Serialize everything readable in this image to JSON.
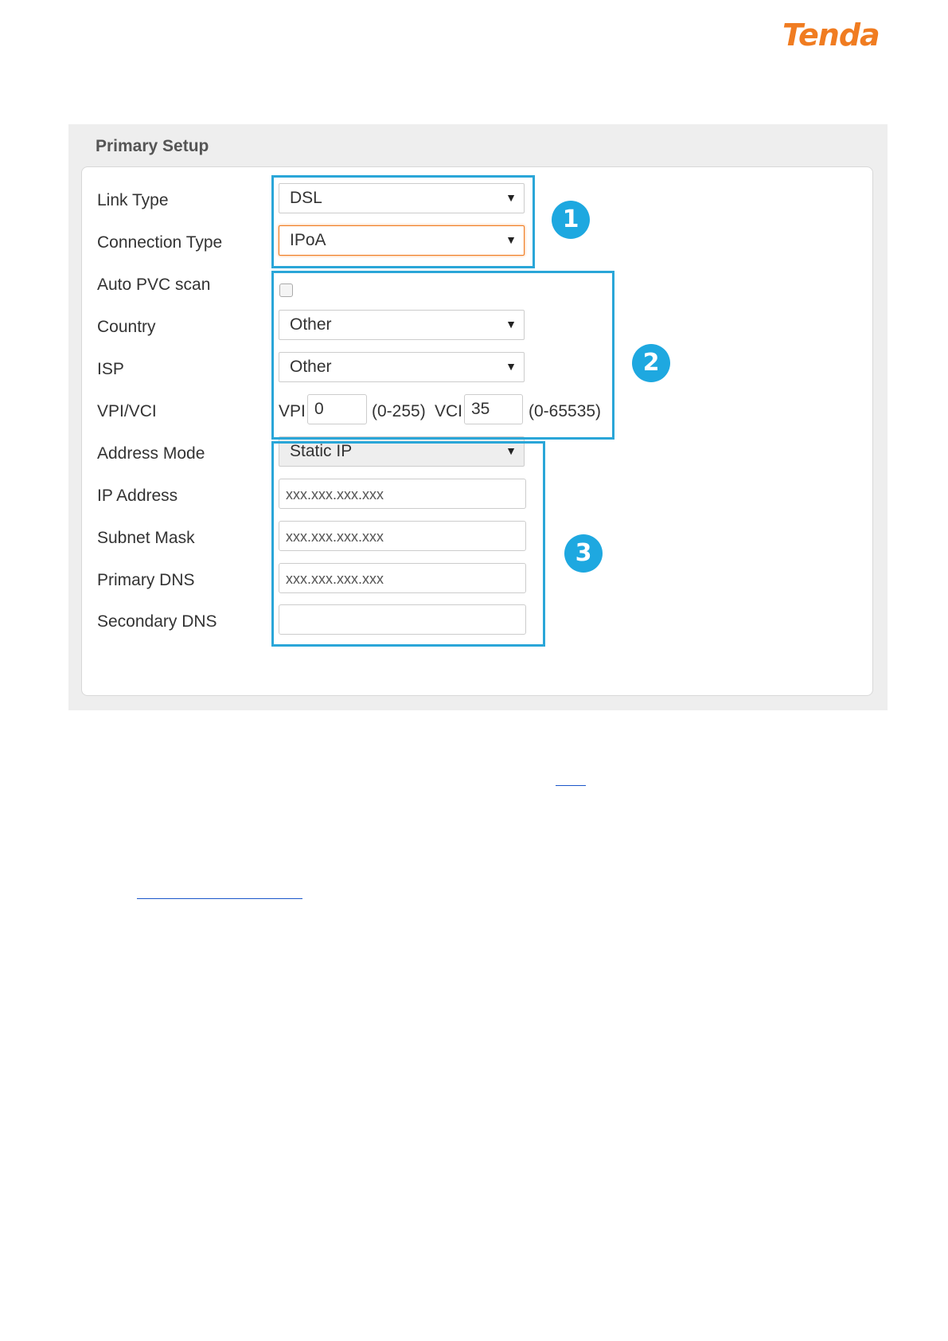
{
  "brand": {
    "logo_text": "Tenda",
    "accent": "#f07c21",
    "highlight": "#2aa6d8"
  },
  "panel": {
    "title": "Primary Setup"
  },
  "form": {
    "link_type": {
      "label": "Link Type",
      "value": "DSL"
    },
    "connection_type": {
      "label": "Connection Type",
      "value": "IPoA"
    },
    "auto_pvc_scan": {
      "label": "Auto PVC scan",
      "checked": false
    },
    "country": {
      "label": "Country",
      "value": "Other"
    },
    "isp": {
      "label": "ISP",
      "value": "Other"
    },
    "vpi_vci": {
      "label": "VPI/VCI",
      "vpi_label": "VPI",
      "vpi_value": "0",
      "vpi_range": "(0-255)",
      "vci_label": "VCI",
      "vci_value": "35",
      "vci_range": "(0-65535)"
    },
    "address_mode": {
      "label": "Address Mode",
      "value": "Static IP"
    },
    "ip_address": {
      "label": "IP Address",
      "value": "xxx.xxx.xxx.xxx"
    },
    "subnet_mask": {
      "label": "Subnet Mask",
      "value": "xxx.xxx.xxx.xxx"
    },
    "primary_dns": {
      "label": "Primary DNS",
      "value": "xxx.xxx.xxx.xxx"
    },
    "secondary_dns": {
      "label": "Secondary DNS",
      "value": ""
    }
  },
  "callouts": [
    "1",
    "2",
    "3"
  ],
  "dropdown_arrow": "▼"
}
